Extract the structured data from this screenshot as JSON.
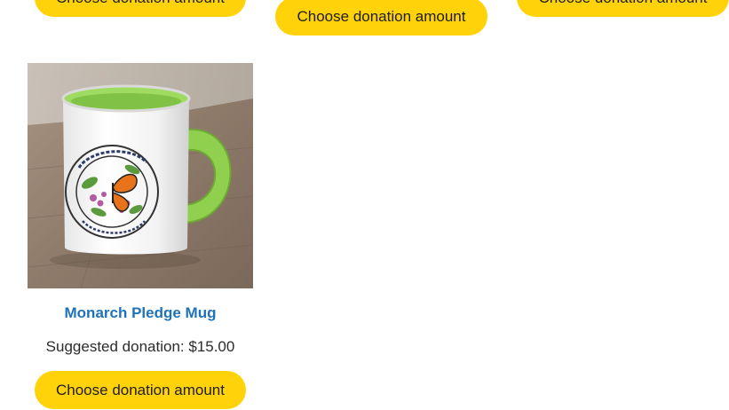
{
  "buttons": {
    "top_left_label": "Choose donation amount",
    "top_center_label": "Choose donation amount",
    "top_right_label": "Choose donation amount"
  },
  "product": {
    "title": "Monarch Pledge Mug",
    "price_label": "Suggested donation: $15.00",
    "button_label": "Choose donation amount",
    "image_icon": "mug-photo"
  },
  "colors": {
    "button": "#ffd20a",
    "title_link": "#1f73b7",
    "mug_inner": "#8fd14f"
  }
}
